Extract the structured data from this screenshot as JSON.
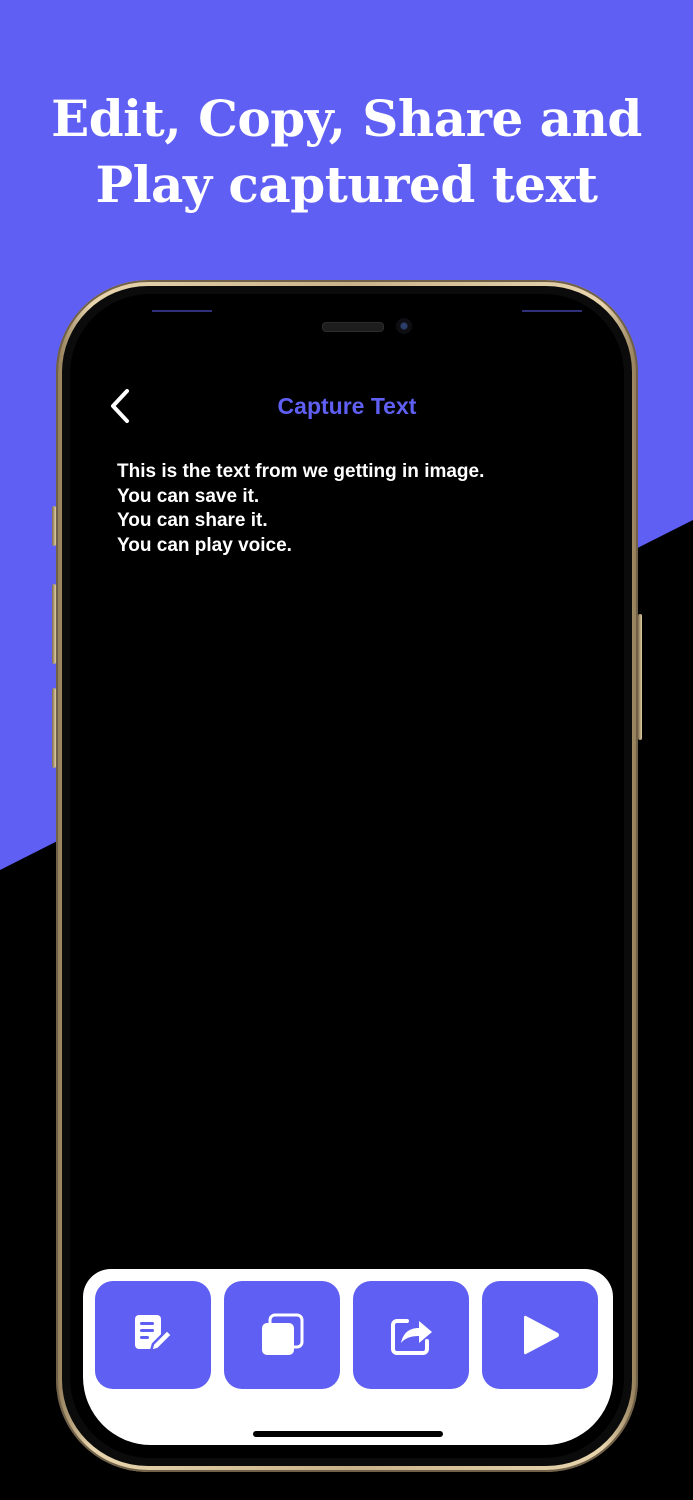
{
  "headline": {
    "line1": "Edit, Copy, Share and",
    "line2": "Play captured text"
  },
  "nav": {
    "back_icon": "chevron-left-icon",
    "title": "Capture Text"
  },
  "captured_text": {
    "lines": [
      "This is the text from we getting in image.",
      "You can save it.",
      "You can share it.",
      "You can play voice."
    ]
  },
  "toolbar": {
    "buttons": [
      {
        "icon": "edit-icon"
      },
      {
        "icon": "copy-icon"
      },
      {
        "icon": "share-icon"
      },
      {
        "icon": "play-icon"
      }
    ]
  },
  "colors": {
    "accent": "#5f5ff3",
    "background": "#000000",
    "text": "#ffffff",
    "toolbar_bg": "#ffffff"
  }
}
